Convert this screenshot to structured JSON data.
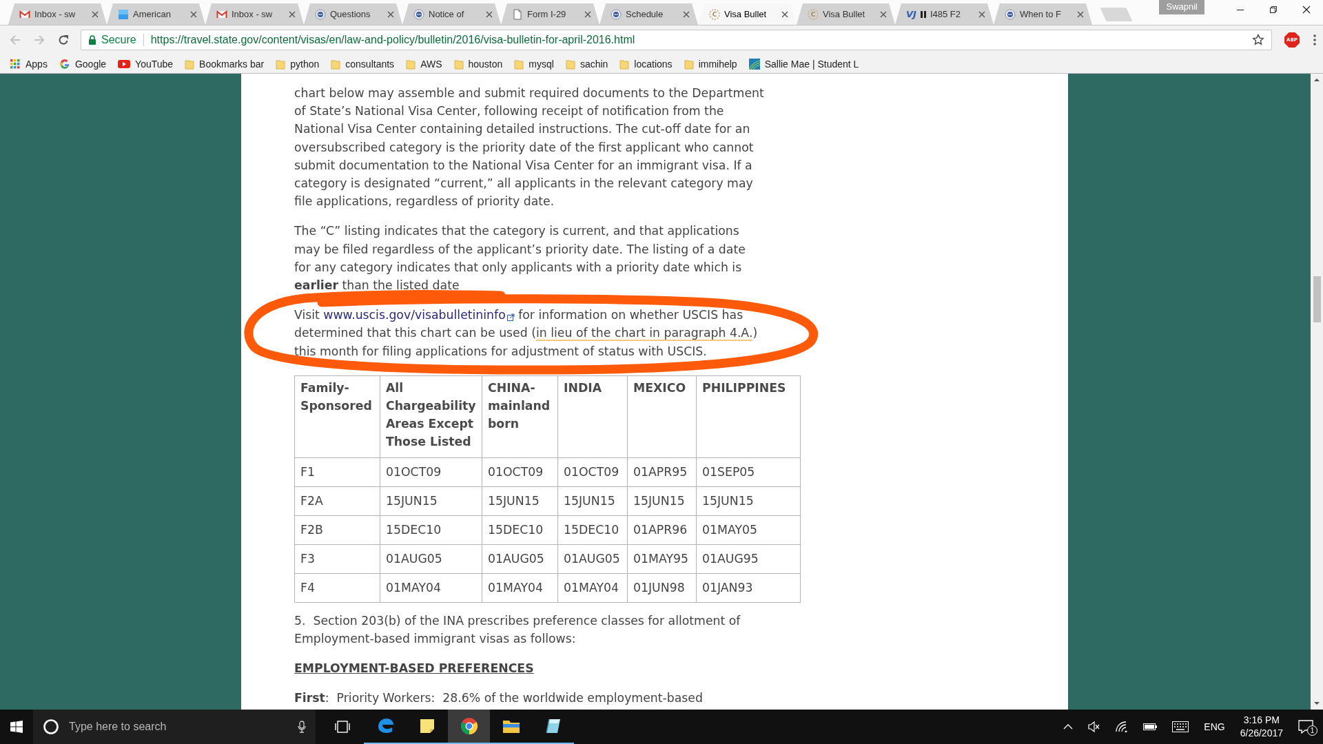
{
  "tabs": [
    {
      "title": "Inbox - sw",
      "kind": "mail",
      "selected": false,
      "media": false
    },
    {
      "title": "American",
      "kind": "square",
      "selected": false,
      "media": false
    },
    {
      "title": "Inbox - sw",
      "kind": "mail",
      "selected": false,
      "media": false
    },
    {
      "title": "Questions",
      "kind": "seal",
      "selected": false,
      "media": false
    },
    {
      "title": "Notice of",
      "kind": "seal",
      "selected": false,
      "media": false
    },
    {
      "title": "Form I-29",
      "kind": "page",
      "selected": false,
      "media": false
    },
    {
      "title": "Schedule",
      "kind": "seal",
      "selected": false,
      "media": false
    },
    {
      "title": "Visa Bullet",
      "kind": "letter",
      "icon_text": "C",
      "selected": true,
      "media": false
    },
    {
      "title": "Visa Bullet",
      "kind": "letter",
      "icon_text": "C",
      "selected": false,
      "media": false
    },
    {
      "title": "I485 F2",
      "kind": "logo",
      "icon_text": "VJ",
      "selected": false,
      "media": true
    },
    {
      "title": "When to F",
      "kind": "seal",
      "selected": false,
      "media": false
    }
  ],
  "profile": "Swapnil",
  "navigation": {
    "back": {
      "disabled": true
    },
    "forward": {
      "disabled": true
    }
  },
  "address": {
    "security": "Secure",
    "url": "https://travel.state.gov/content/visas/en/law-and-policy/bulletin/2016/visa-bulletin-for-april-2016.html"
  },
  "extension": "ABP",
  "bookmarks": [
    {
      "label": "Apps",
      "kind": "apps"
    },
    {
      "label": "Google",
      "kind": "google"
    },
    {
      "label": "YouTube",
      "kind": "youtube"
    },
    {
      "label": "Bookmarks bar",
      "kind": "folder"
    },
    {
      "label": "python",
      "kind": "folder"
    },
    {
      "label": "consultants",
      "kind": "folder"
    },
    {
      "label": "AWS",
      "kind": "folder"
    },
    {
      "label": "houston",
      "kind": "folder"
    },
    {
      "label": "mysql",
      "kind": "folder"
    },
    {
      "label": "sachin",
      "kind": "folder"
    },
    {
      "label": "locations",
      "kind": "folder"
    },
    {
      "label": "immihelp",
      "kind": "folder"
    },
    {
      "label": "Sallie Mae | Student L",
      "kind": "site"
    }
  ],
  "page": {
    "paragraphs": [
      "chart below may assemble and submit required documents to the Department of State’s National Visa Center, following receipt of notification from the National Visa Center containing detailed instructions. The cut-off date for an oversubscribed category is the priority date of the first applicant who cannot submit documentation to the National Visa Center for an immigrant visa. If a category is designated “current,” all applicants in the relevant category may file applications, regardless of priority date.",
      "The “C” listing indicates that the category is current, and that applications may be filed regardless of the applicant’s priority date. The listing of a date for any category indicates that only applicants with a priority date which is **earlier** than the listed date"
    ],
    "notice": {
      "before": "Visit ",
      "link": "www.uscis.gov/visabulletininfo",
      "after": " for information on whether USCIS has determined that this chart can be used (",
      "underlined": "in lieu of the chart in paragraph 4.A.",
      "end": ") this month for filing applications for adjustment of status with USCIS."
    },
    "table": {
      "columns": [
        "Family-Sponsored",
        "All Chargeability Areas Except Those Listed",
        "CHINA-mainland born",
        "INDIA",
        "MEXICO",
        "PHILIPPINES"
      ],
      "rows": [
        [
          "F1",
          "01OCT09",
          "01OCT09",
          "01OCT09",
          "01APR95",
          "01SEP05"
        ],
        [
          "F2A",
          "15JUN15",
          "15JUN15",
          "15JUN15",
          "15JUN15",
          "15JUN15"
        ],
        [
          "F2B",
          "15DEC10",
          "15DEC10",
          "15DEC10",
          "01APR96",
          "01MAY05"
        ],
        [
          "F3",
          "01AUG05",
          "01AUG05",
          "01AUG05",
          "01MAY95",
          "01AUG95"
        ],
        [
          "F4",
          "01MAY04",
          "01MAY04",
          "01MAY04",
          "01JUN98",
          "01JAN93"
        ]
      ]
    },
    "section": "5.  Section 203(b) of the INA prescribes preference classes for allotment of Employment-based immigrant visas as follows:",
    "heading": "EMPLOYMENT-BASED PREFERENCES",
    "first": "**First**:  Priority Workers:  28.6% of the worldwide employment-based"
  },
  "taskbar": {
    "search": {
      "placeholder": "Type here to search"
    },
    "apps": [
      {
        "kind": "edge",
        "running": true,
        "selected": false
      },
      {
        "kind": "notes",
        "running": true,
        "selected": false
      },
      {
        "kind": "chrome",
        "running": true,
        "selected": true
      },
      {
        "kind": "explorer",
        "running": true,
        "selected": false
      },
      {
        "kind": "app",
        "running": true,
        "selected": false
      }
    ],
    "language": "ENG",
    "time": "3:16 PM",
    "date": "6/26/2017",
    "notifications": "1"
  }
}
